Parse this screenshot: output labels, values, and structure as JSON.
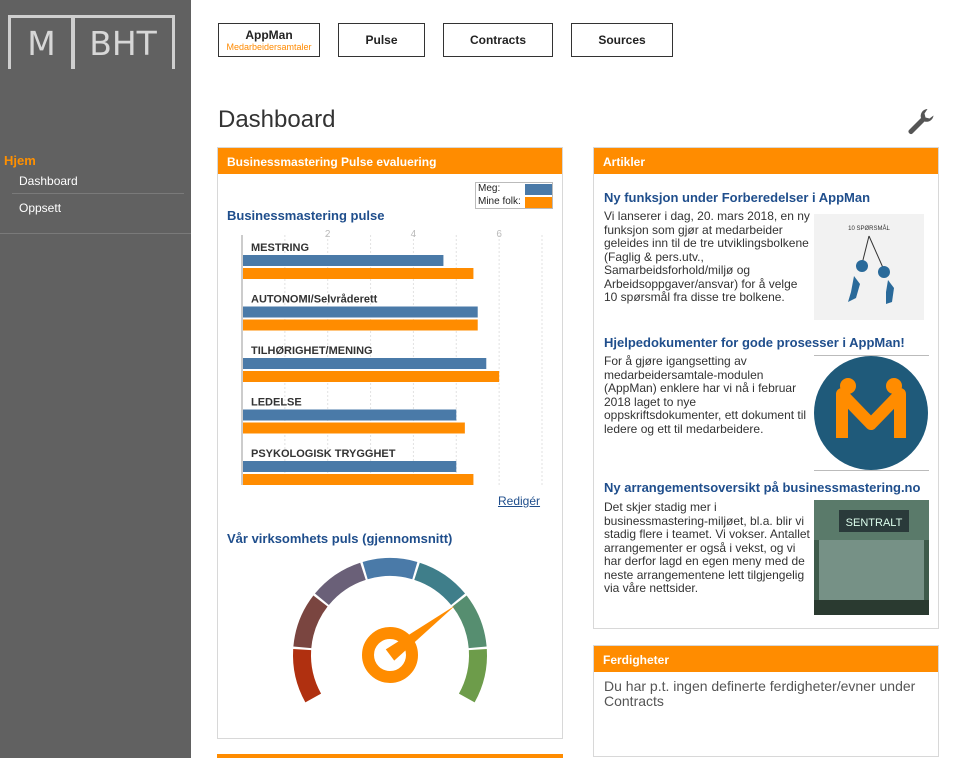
{
  "logo": {
    "left": "M",
    "right": "BHT"
  },
  "sidebar": {
    "section": "Hjem",
    "items": [
      {
        "label": "Dashboard"
      },
      {
        "label": "Oppsett"
      }
    ]
  },
  "topnav": [
    {
      "label": "AppMan",
      "sublabel": "Medarbeidersamtaler"
    },
    {
      "label": "Pulse"
    },
    {
      "label": "Contracts"
    },
    {
      "label": "Sources"
    }
  ],
  "page": {
    "title": "Dashboard",
    "settings_icon": "wrench-icon"
  },
  "pulse_panel": {
    "header": "Businessmastering Pulse evaluering",
    "chart_title": "Businessmastering pulse",
    "edit_link": "Redigér",
    "gauge_title": "Vår virksomhets puls (gjennomsnitt)",
    "gauge_value": 0.72
  },
  "chart_data": {
    "type": "bar",
    "orientation": "horizontal",
    "categories": [
      "MESTRING",
      "AUTONOMI/Selvråderett",
      "TILHØRIGHET/MENING",
      "LEDELSE",
      "PSYKOLOGISK TRYGGHET"
    ],
    "series": [
      {
        "name": "Meg:",
        "color": "#4a7aa8",
        "values": [
          4.7,
          5.5,
          5.7,
          5.0,
          5.0
        ]
      },
      {
        "name": "Mine folk:",
        "color": "#ff8c00",
        "values": [
          5.4,
          5.5,
          6.0,
          5.2,
          5.4
        ]
      }
    ],
    "xticks": [
      "2",
      "4",
      "6"
    ],
    "xlim": [
      0,
      7
    ],
    "grid": true,
    "legend": "top-right"
  },
  "articles_panel": {
    "header": "Artikler",
    "articles": [
      {
        "title": "Ny funksjon under Forberedelser i AppMan",
        "text": "Vi lanserer i dag, 20. mars 2018, en ny funksjon som gjør at medarbeider geleides inn til de tre utviklingsbolkene (Faglig & pers.utv., Samarbeidsforhold/miljø og Arbeidsoppgaver/ansvar) for å velge 10 spørsmål fra disse tre bolkene.",
        "image_caption": "10 SPØRSMÅL"
      },
      {
        "title": "Hjelpedokumenter for gode prosesser i AppMan!",
        "text": "For å gjøre igangsetting av medarbeidersamtale-modulen (AppMan) enklere har vi nå i februar 2018 laget to nye oppskriftsdokumenter, ett dokument til ledere og ett til medarbeidere."
      },
      {
        "title": "Ny arrangementsoversikt på businessmastering.no",
        "text": "Det skjer stadig mer i businessmastering-miljøet, bl.a. blir vi stadig flere i teamet. Vi vokser. Antallet arrangementer er også i vekst, og vi har derfor lagd en egen meny med de neste arrangementene lett tilgjengelig via våre nettsider.",
        "image_caption": "SENTRALT"
      }
    ]
  },
  "skills_panel": {
    "header": "Ferdigheter",
    "text": "Du har p.t. ingen definerte ferdigheter/evner under Contracts"
  }
}
